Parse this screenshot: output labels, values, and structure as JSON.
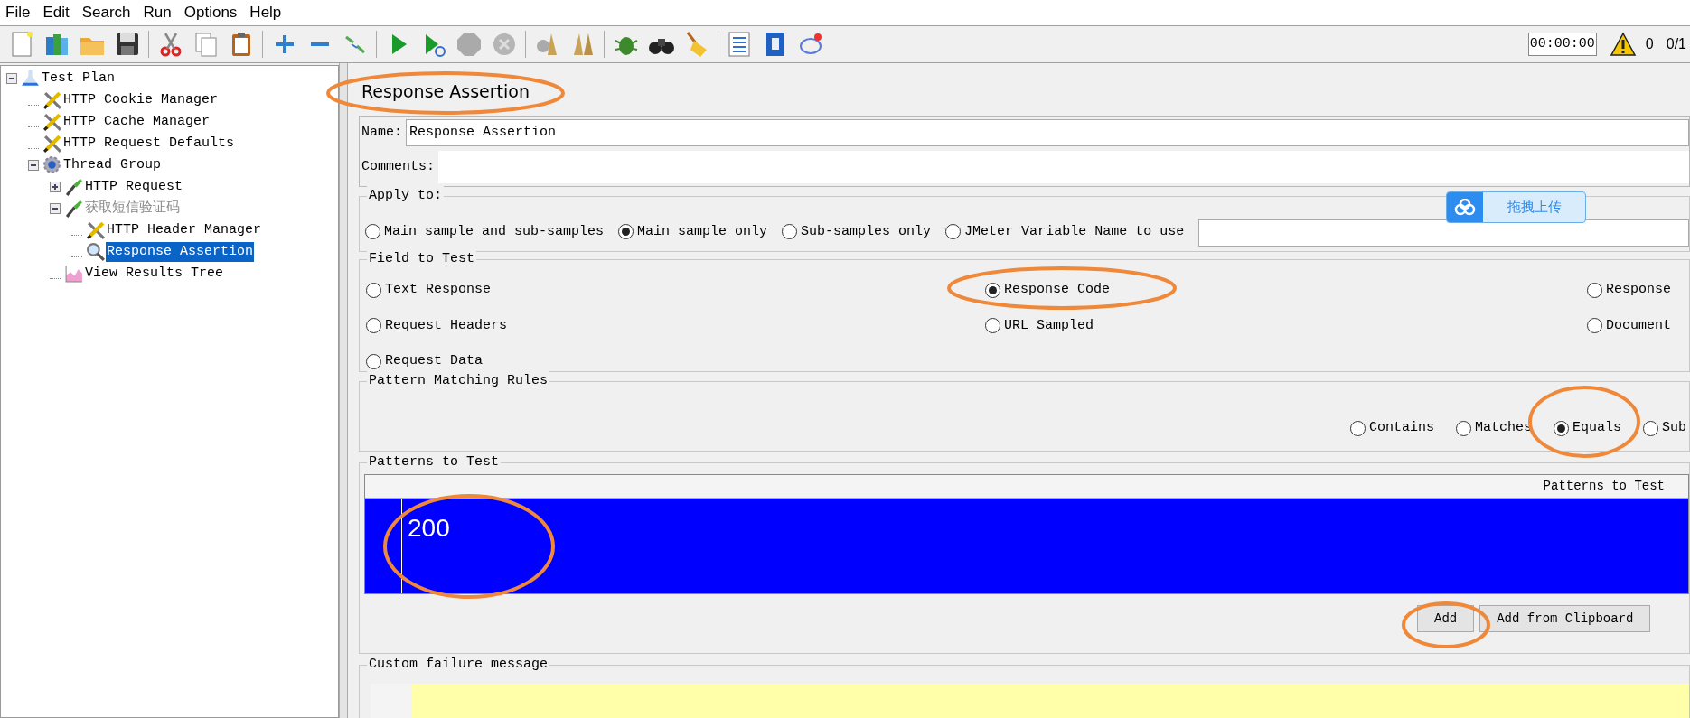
{
  "menu": [
    "File",
    "Edit",
    "Search",
    "Run",
    "Options",
    "Help"
  ],
  "status": {
    "timer": "00:00:00",
    "warnings": "0",
    "threads": "0/1"
  },
  "tree": [
    {
      "label": "Test Plan",
      "kind": "plan",
      "expanded": true,
      "selected": false,
      "disabled": false,
      "children": [
        {
          "label": "HTTP Cookie Manager",
          "kind": "config",
          "selected": false,
          "disabled": false
        },
        {
          "label": "HTTP Cache Manager",
          "kind": "config",
          "selected": false,
          "disabled": false
        },
        {
          "label": "HTTP Request Defaults",
          "kind": "config",
          "selected": false,
          "disabled": false
        },
        {
          "label": "Thread Group",
          "kind": "threads",
          "expanded": true,
          "selected": false,
          "disabled": false,
          "children": [
            {
              "label": "HTTP Request",
              "kind": "sampler",
              "expanded": false,
              "selected": false,
              "disabled": false
            },
            {
              "label": "获取短信验证码",
              "kind": "sampler",
              "expanded": true,
              "selected": false,
              "disabled": true,
              "children": [
                {
                  "label": "HTTP Header Manager",
                  "kind": "config",
                  "selected": false,
                  "disabled": false
                },
                {
                  "label": "Response Assertion",
                  "kind": "assertion",
                  "selected": true,
                  "disabled": false
                }
              ]
            },
            {
              "label": "View Results Tree",
              "kind": "listener",
              "selected": false,
              "disabled": false
            }
          ]
        }
      ]
    }
  ],
  "editor": {
    "title": "Response Assertion",
    "name_label": "Name:",
    "name": "Response Assertion",
    "comments_label": "Comments:",
    "apply_to": {
      "title": "Apply to:",
      "options": [
        {
          "label": "Main sample and sub-samples",
          "selected": false
        },
        {
          "label": "Main sample only",
          "selected": true
        },
        {
          "label": "Sub-samples only",
          "selected": false
        },
        {
          "label": "JMeter Variable Name to use",
          "selected": false
        }
      ]
    },
    "field_to_test": {
      "title": "Field to Test",
      "options": [
        {
          "label": "Text Response",
          "selected": false
        },
        {
          "label": "Response Code",
          "selected": true
        },
        {
          "label": "Response",
          "selected": false
        },
        {
          "label": "Request Headers",
          "selected": false
        },
        {
          "label": "URL Sampled",
          "selected": false
        },
        {
          "label": "Document",
          "selected": false
        },
        {
          "label": "Request Data",
          "selected": false
        }
      ]
    },
    "pattern_rules": {
      "title": "Pattern Matching Rules",
      "options": [
        {
          "label": "Contains",
          "selected": false
        },
        {
          "label": "Matches",
          "selected": false
        },
        {
          "label": "Equals",
          "selected": true
        },
        {
          "label": "Sub",
          "selected": false
        }
      ]
    },
    "patterns": {
      "title": "Patterns to Test",
      "column": "Patterns to Test",
      "rows": [
        {
          "value": "200",
          "selected": true
        }
      ],
      "buttons": [
        "Add",
        "Add from Clipboard"
      ]
    },
    "failure_message": {
      "title": "Custom failure message"
    }
  },
  "upload_widget": {
    "label": "拖拽上传"
  }
}
